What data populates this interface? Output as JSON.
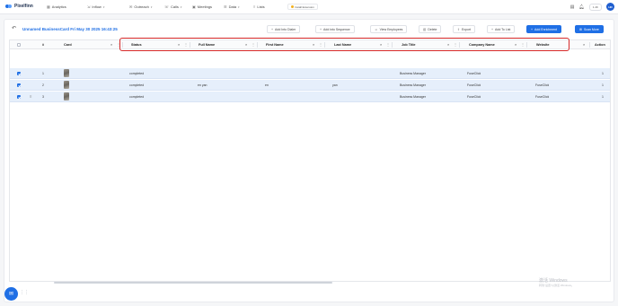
{
  "nav": {
    "brand": "Pixelfinn",
    "items": [
      {
        "label": "Analytics",
        "icon": "chart-icon"
      },
      {
        "label": "Inflow",
        "icon": "inflow-icon",
        "dropdown": true
      },
      {
        "label": "Outreach",
        "icon": "outreach-icon",
        "dropdown": true
      },
      {
        "label": "Calls",
        "icon": "phone-icon",
        "dropdown": true
      },
      {
        "label": "Meetings",
        "icon": "calendar-icon"
      },
      {
        "label": "Data",
        "icon": "database-icon",
        "dropdown": true
      },
      {
        "label": "Lists",
        "icon": "list-icon"
      }
    ],
    "install_label": "Install Extension",
    "credits": "1.4K",
    "avatar_initials": "HD"
  },
  "toolbar": {
    "title": "Unnamed BusinessCard Fri May 30 2025 16:43:25",
    "buttons": {
      "add_into_dialer": "Add Into Dialer",
      "add_into_sequence": "Add into Sequence",
      "view_employees": "View Employees",
      "delete": "Delete",
      "export": "Export",
      "add_to_list": "Add To List",
      "add_enrichment": "Add Enrichment",
      "scan_more": "Scan More"
    }
  },
  "table": {
    "headers": {
      "index": "#",
      "card": "Card",
      "status": "Status",
      "full_name": "Full Name",
      "first_name": "First Name",
      "last_name": "Last Name",
      "job_title": "Job Title",
      "company_name": "Company Name",
      "website": "Website",
      "action": "Action"
    },
    "rows": [
      {
        "index": "1",
        "status": "completed",
        "full_name": "",
        "first_name": "",
        "last_name": "",
        "job_title": "Business Manager",
        "company_name": "FuseClick",
        "website": "",
        "action": "1"
      },
      {
        "index": "2",
        "status": "completed",
        "full_name": "en yan",
        "first_name": "en",
        "last_name": "yan",
        "job_title": "Business Manager",
        "company_name": "FuseClick",
        "website": "FuseClick",
        "action": "1"
      },
      {
        "index": "3",
        "status": "completed",
        "full_name": "",
        "first_name": "",
        "last_name": "",
        "job_title": "Business Manager",
        "company_name": "FuseClick",
        "website": "FuseClick",
        "action": "1"
      }
    ]
  },
  "watermark": {
    "line1": "激活 Windows",
    "line2": "转到“设置”以激活 Windows。"
  },
  "colors": {
    "accent": "#1f6fe5",
    "highlight": "#d62828",
    "row_selected": "#e6effb"
  }
}
